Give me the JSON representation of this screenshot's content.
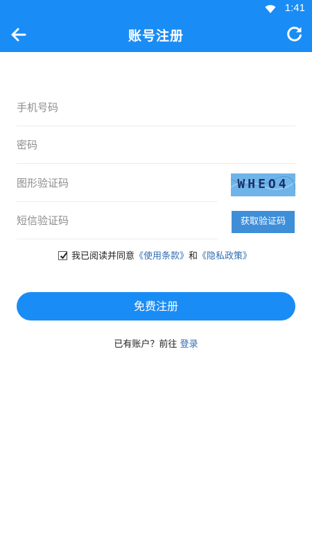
{
  "status_bar": {
    "time": "1:41",
    "wifi_icon": "wifi-icon",
    "battery_icon": "battery-icon"
  },
  "app_bar": {
    "title": "账号注册",
    "back_icon": "back-arrow-icon",
    "refresh_icon": "refresh-icon",
    "color": "#1a8cf5"
  },
  "form": {
    "phone_placeholder": "手机号码",
    "password_placeholder": "密码",
    "captcha_placeholder": "图形验证码",
    "captcha_text": "WHEO4",
    "sms_placeholder": "短信验证码",
    "sms_button": "获取验证码"
  },
  "agreement": {
    "checked": true,
    "prefix": "我已阅读并同意",
    "terms": "《使用条款》",
    "conjunction": "和",
    "privacy": "《隐私政策》"
  },
  "register_button": "免费注册",
  "login_prompt": {
    "text": "已有账户？前往 ",
    "link": "登录"
  }
}
